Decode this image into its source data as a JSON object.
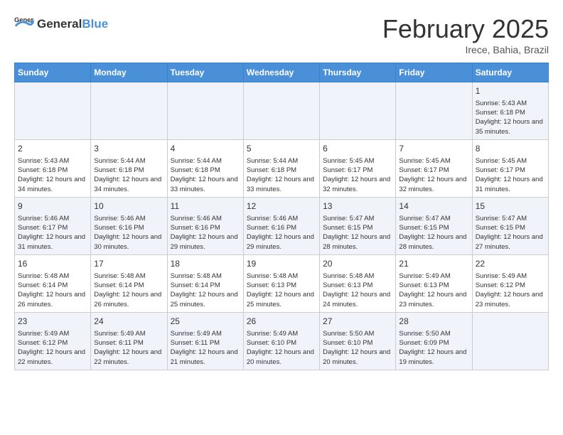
{
  "header": {
    "logo_general": "General",
    "logo_blue": "Blue",
    "month_title": "February 2025",
    "location": "Irece, Bahia, Brazil"
  },
  "days_of_week": [
    "Sunday",
    "Monday",
    "Tuesday",
    "Wednesday",
    "Thursday",
    "Friday",
    "Saturday"
  ],
  "weeks": [
    [
      {
        "day": "",
        "info": ""
      },
      {
        "day": "",
        "info": ""
      },
      {
        "day": "",
        "info": ""
      },
      {
        "day": "",
        "info": ""
      },
      {
        "day": "",
        "info": ""
      },
      {
        "day": "",
        "info": ""
      },
      {
        "day": "1",
        "info": "Sunrise: 5:43 AM\nSunset: 6:18 PM\nDaylight: 12 hours and 35 minutes."
      }
    ],
    [
      {
        "day": "2",
        "info": "Sunrise: 5:43 AM\nSunset: 6:18 PM\nDaylight: 12 hours and 34 minutes."
      },
      {
        "day": "3",
        "info": "Sunrise: 5:44 AM\nSunset: 6:18 PM\nDaylight: 12 hours and 34 minutes."
      },
      {
        "day": "4",
        "info": "Sunrise: 5:44 AM\nSunset: 6:18 PM\nDaylight: 12 hours and 33 minutes."
      },
      {
        "day": "5",
        "info": "Sunrise: 5:44 AM\nSunset: 6:18 PM\nDaylight: 12 hours and 33 minutes."
      },
      {
        "day": "6",
        "info": "Sunrise: 5:45 AM\nSunset: 6:17 PM\nDaylight: 12 hours and 32 minutes."
      },
      {
        "day": "7",
        "info": "Sunrise: 5:45 AM\nSunset: 6:17 PM\nDaylight: 12 hours and 32 minutes."
      },
      {
        "day": "8",
        "info": "Sunrise: 5:45 AM\nSunset: 6:17 PM\nDaylight: 12 hours and 31 minutes."
      }
    ],
    [
      {
        "day": "9",
        "info": "Sunrise: 5:46 AM\nSunset: 6:17 PM\nDaylight: 12 hours and 31 minutes."
      },
      {
        "day": "10",
        "info": "Sunrise: 5:46 AM\nSunset: 6:16 PM\nDaylight: 12 hours and 30 minutes."
      },
      {
        "day": "11",
        "info": "Sunrise: 5:46 AM\nSunset: 6:16 PM\nDaylight: 12 hours and 29 minutes."
      },
      {
        "day": "12",
        "info": "Sunrise: 5:46 AM\nSunset: 6:16 PM\nDaylight: 12 hours and 29 minutes."
      },
      {
        "day": "13",
        "info": "Sunrise: 5:47 AM\nSunset: 6:15 PM\nDaylight: 12 hours and 28 minutes."
      },
      {
        "day": "14",
        "info": "Sunrise: 5:47 AM\nSunset: 6:15 PM\nDaylight: 12 hours and 28 minutes."
      },
      {
        "day": "15",
        "info": "Sunrise: 5:47 AM\nSunset: 6:15 PM\nDaylight: 12 hours and 27 minutes."
      }
    ],
    [
      {
        "day": "16",
        "info": "Sunrise: 5:48 AM\nSunset: 6:14 PM\nDaylight: 12 hours and 26 minutes."
      },
      {
        "day": "17",
        "info": "Sunrise: 5:48 AM\nSunset: 6:14 PM\nDaylight: 12 hours and 26 minutes."
      },
      {
        "day": "18",
        "info": "Sunrise: 5:48 AM\nSunset: 6:14 PM\nDaylight: 12 hours and 25 minutes."
      },
      {
        "day": "19",
        "info": "Sunrise: 5:48 AM\nSunset: 6:13 PM\nDaylight: 12 hours and 25 minutes."
      },
      {
        "day": "20",
        "info": "Sunrise: 5:48 AM\nSunset: 6:13 PM\nDaylight: 12 hours and 24 minutes."
      },
      {
        "day": "21",
        "info": "Sunrise: 5:49 AM\nSunset: 6:13 PM\nDaylight: 12 hours and 23 minutes."
      },
      {
        "day": "22",
        "info": "Sunrise: 5:49 AM\nSunset: 6:12 PM\nDaylight: 12 hours and 23 minutes."
      }
    ],
    [
      {
        "day": "23",
        "info": "Sunrise: 5:49 AM\nSunset: 6:12 PM\nDaylight: 12 hours and 22 minutes."
      },
      {
        "day": "24",
        "info": "Sunrise: 5:49 AM\nSunset: 6:11 PM\nDaylight: 12 hours and 22 minutes."
      },
      {
        "day": "25",
        "info": "Sunrise: 5:49 AM\nSunset: 6:11 PM\nDaylight: 12 hours and 21 minutes."
      },
      {
        "day": "26",
        "info": "Sunrise: 5:49 AM\nSunset: 6:10 PM\nDaylight: 12 hours and 20 minutes."
      },
      {
        "day": "27",
        "info": "Sunrise: 5:50 AM\nSunset: 6:10 PM\nDaylight: 12 hours and 20 minutes."
      },
      {
        "day": "28",
        "info": "Sunrise: 5:50 AM\nSunset: 6:09 PM\nDaylight: 12 hours and 19 minutes."
      },
      {
        "day": "",
        "info": ""
      }
    ]
  ]
}
